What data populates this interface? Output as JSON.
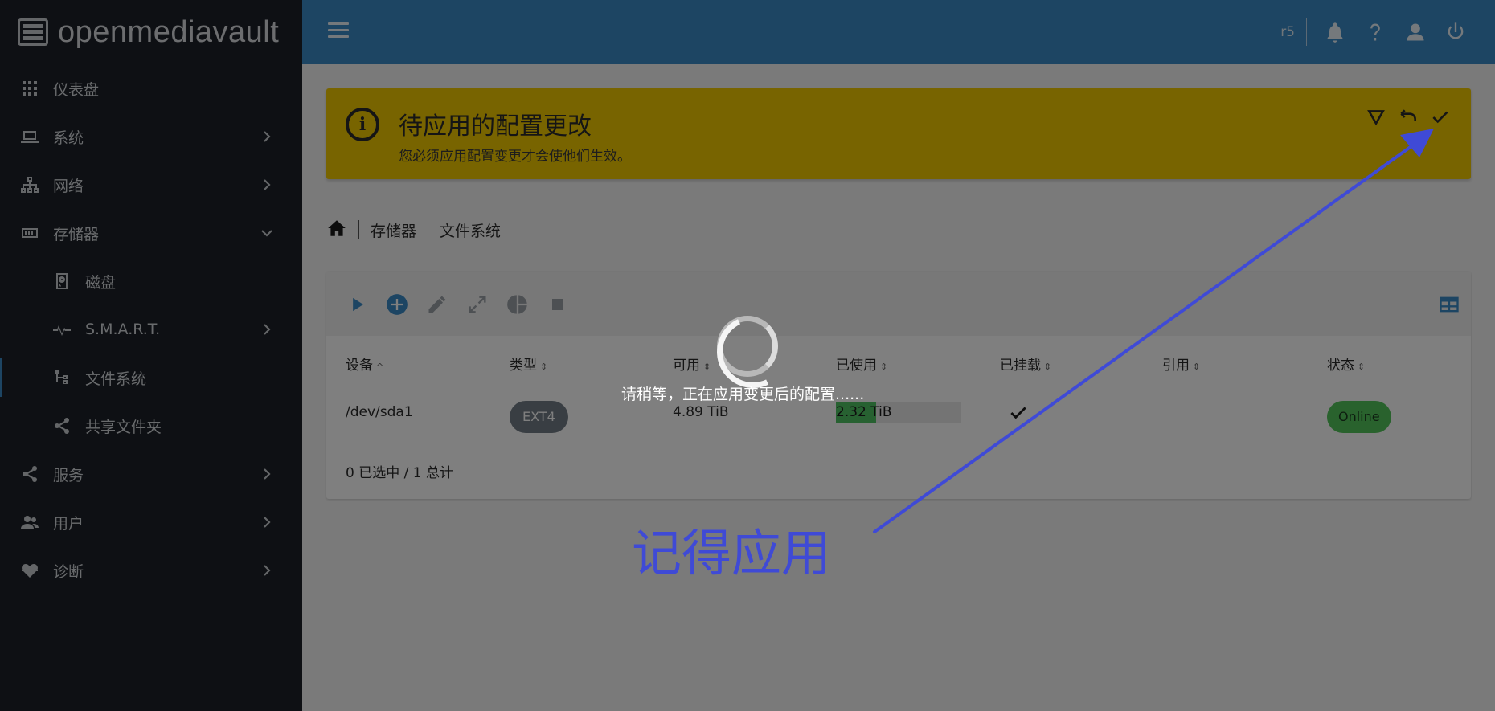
{
  "app": {
    "brand": "openmediavault"
  },
  "sidebar": {
    "items": [
      {
        "label": "仪表盘",
        "icon": "dashboard-grid-icon"
      },
      {
        "label": "系统",
        "icon": "laptop-icon"
      },
      {
        "label": "网络",
        "icon": "network-icon"
      },
      {
        "label": "存储器",
        "icon": "storage-icon"
      },
      {
        "label": "磁盘",
        "icon": "disk-icon"
      },
      {
        "label": "S.M.A.R.T.",
        "icon": "pulse-icon"
      },
      {
        "label": "文件系统",
        "icon": "filesystem-tree-icon"
      },
      {
        "label": "共享文件夹",
        "icon": "share-icon"
      },
      {
        "label": "服务",
        "icon": "share-icon"
      },
      {
        "label": "用户",
        "icon": "users-icon"
      },
      {
        "label": "诊断",
        "icon": "heart-pulse-icon"
      }
    ]
  },
  "topbar": {
    "host": "r5"
  },
  "alert": {
    "title": "待应用的配置更改",
    "text": "您必须应用配置变更才会使他们生效。"
  },
  "breadcrumb": {
    "items": [
      "存储器",
      "文件系统"
    ]
  },
  "table": {
    "columns": [
      "设备",
      "类型",
      "可用",
      "已使用",
      "已挂载",
      "引用",
      "状态"
    ],
    "rows": [
      {
        "device": "/dev/sda1",
        "type": "EXT4",
        "available": "4.89 TiB",
        "used": "2.32 TiB",
        "used_fraction": 0.32,
        "mounted": true,
        "references": "",
        "status": "Online"
      }
    ],
    "footer": "0 已选中 / 1 总计"
  },
  "overlay": {
    "message": "请稍等，正在应用变更后的配置......"
  },
  "annotation": {
    "text": "记得应用",
    "color": "#3f4ad6"
  },
  "colors": {
    "accent": "#3b8bc7",
    "warning": "#f0c800",
    "success": "#52c55a"
  }
}
